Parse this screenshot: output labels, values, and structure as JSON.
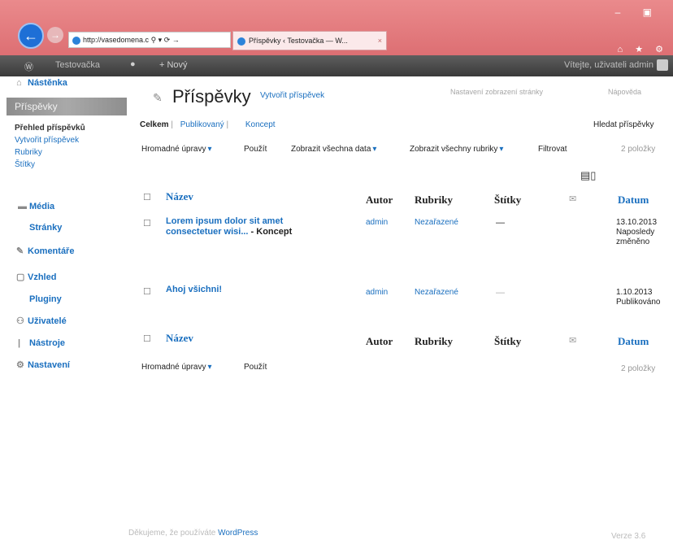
{
  "browser": {
    "address": "http://vasedomena.c",
    "address_icons": "⚲ ▾ ⟳ →",
    "tab_title": "Příspěvky ‹ Testovačka — W...",
    "tab_close": "×",
    "window_controls": "– ▣",
    "toolbar_icons": "⌂ ★ ⚙"
  },
  "adminbar": {
    "wp_icon": "wordpress-icon",
    "site_name": "Testovačka",
    "comments_icon": "●",
    "new": "+ Nový",
    "howdy": "Vítejte, uživateli admin"
  },
  "sidebar": {
    "dashboard": "Nástěnka",
    "posts": "Příspěvky",
    "sub": [
      "Přehled příspěvků",
      "Vytvořit příspěvek",
      "Rubriky",
      "Štítky"
    ],
    "items": [
      "Média",
      "Stránky",
      "Komentáře",
      "Vzhled",
      "Pluginy",
      "Uživatelé",
      "Nástroje",
      "Nastavení"
    ]
  },
  "main": {
    "title": "Příspěvky",
    "add_new": "Vytvořit příspěvek",
    "screen_options": "Nastavení zobrazení stránky",
    "help": "Nápověda",
    "filters": {
      "all": "Celkem",
      "published": "Publikovaný",
      "draft": "Koncept",
      "sep": "|"
    },
    "search_label": "Hledat příspěvky",
    "bulk_actions": "Hromadné úpravy",
    "apply": "Použít",
    "all_dates": "Zobrazit všechna data",
    "all_categories": "Zobrazit všechny rubriky",
    "filter": "Filtrovat",
    "pages": "2 položky",
    "columns": {
      "title": "Název",
      "author": "Autor",
      "categories": "Rubriky",
      "tags": "Štítky",
      "date": "Datum"
    },
    "rows": [
      {
        "title": "Lorem ipsum dolor sit amet consectetuer wisi...",
        "state": "- Koncept",
        "author": "admin",
        "category": "Nezařazené",
        "tags": "—",
        "date": "13.10.2013 Naposledy změněno"
      },
      {
        "title": "Ahoj všichni!",
        "state": "",
        "author": "admin",
        "category": "Nezařazené",
        "tags": "—",
        "date": "1.10.2013 Publikováno"
      }
    ],
    "footer_thanks": "Děkujeme, že používáte",
    "footer_wp": "WordPress",
    "version": "Verze 3.6"
  }
}
